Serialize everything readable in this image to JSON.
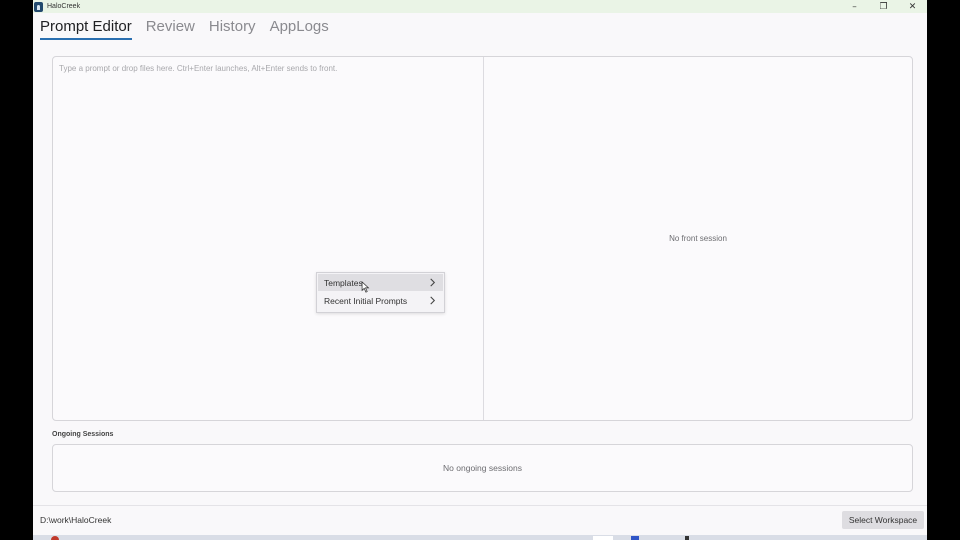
{
  "window": {
    "title": "HaloCreek",
    "controls": {
      "minimize": "–",
      "restore": "❐",
      "close": "✕"
    }
  },
  "tabs": [
    {
      "label": "Prompt Editor",
      "active": true
    },
    {
      "label": "Review",
      "active": false
    },
    {
      "label": "History",
      "active": false
    },
    {
      "label": "AppLogs",
      "active": false
    }
  ],
  "editor": {
    "placeholder": "Type a prompt or drop files here. Ctrl+Enter launches, Alt+Enter sends to front.",
    "value": ""
  },
  "context_menu": {
    "items": [
      {
        "label": "Templates",
        "hovered": true
      },
      {
        "label": "Recent Initial Prompts",
        "hovered": false
      }
    ]
  },
  "front_session": {
    "empty_text": "No front session"
  },
  "ongoing": {
    "label": "Ongoing Sessions",
    "empty_text": "No ongoing sessions"
  },
  "status": {
    "workspace_path": "D:\\work\\HaloCreek",
    "select_workspace_label": "Select Workspace"
  },
  "colors": {
    "accent": "#2a6fb0",
    "titlebar": "#eaf4e6",
    "background": "#f9f8fa"
  }
}
